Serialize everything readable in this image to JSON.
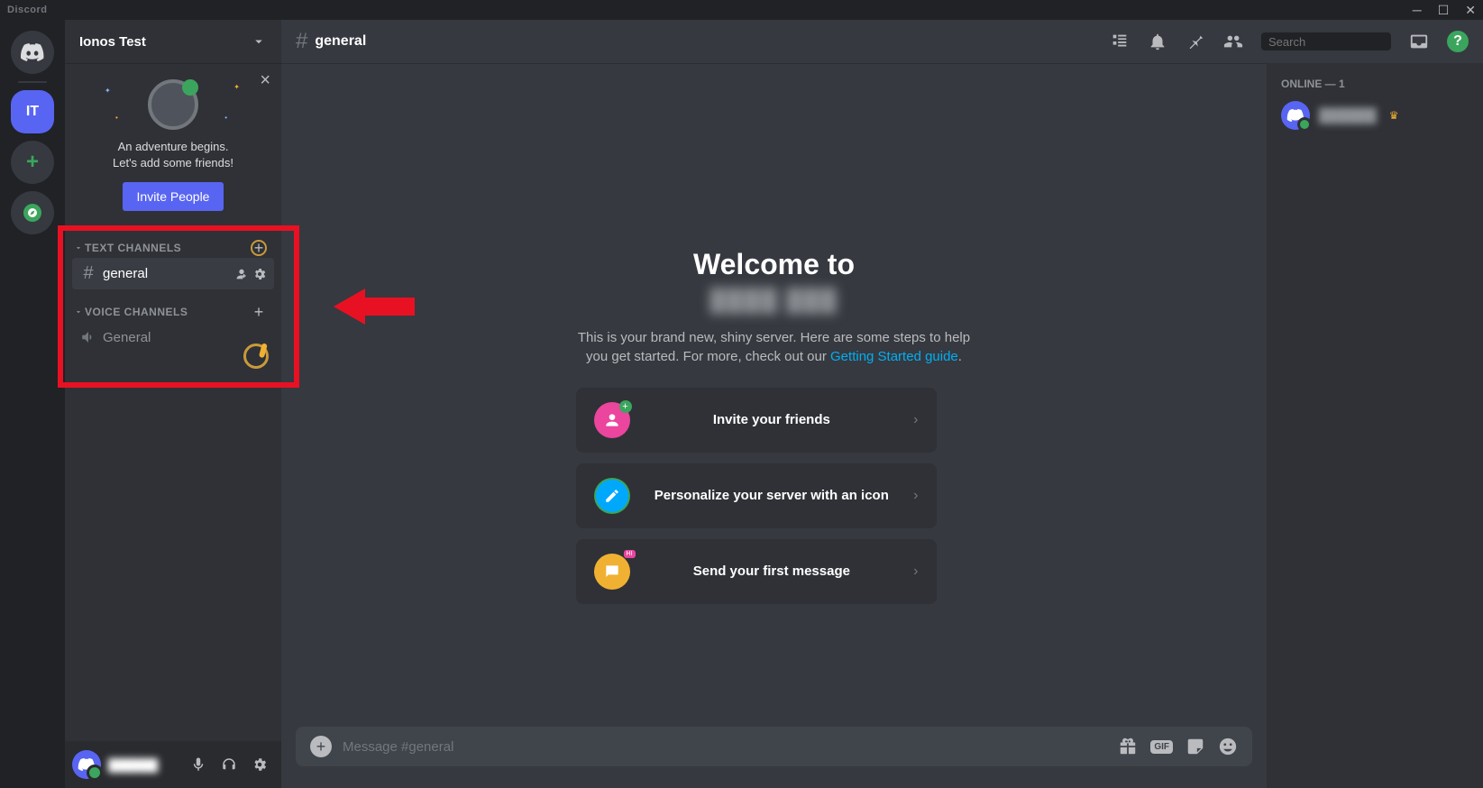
{
  "titlebar": {
    "app_name": "Discord"
  },
  "guilds": {
    "selected_initials": "IT"
  },
  "server": {
    "name": "Ionos Test"
  },
  "sidebar_welcome": {
    "line1": "An adventure begins.",
    "line2": "Let's add some friends!",
    "invite_button": "Invite People"
  },
  "categories": {
    "text": {
      "label": "TEXT CHANNELS",
      "channels": [
        {
          "name": "general",
          "active": true
        }
      ]
    },
    "voice": {
      "label": "VOICE CHANNELS",
      "channels": [
        {
          "name": "General"
        }
      ]
    }
  },
  "header": {
    "channel_name": "general",
    "search_placeholder": "Search"
  },
  "welcome": {
    "title": "Welcome to",
    "server_name_masked": "████ ███",
    "desc_part1": "This is your brand new, shiny server. Here are some steps to help you get started. For more, check out our ",
    "desc_link": "Getting Started guide",
    "desc_part2": "."
  },
  "onboarding": {
    "items": [
      {
        "label": "Invite your friends"
      },
      {
        "label": "Personalize your server with an icon"
      },
      {
        "label": "Send your first message"
      }
    ]
  },
  "message_input": {
    "placeholder": "Message #general"
  },
  "members": {
    "header": "ONLINE — 1",
    "list": [
      {
        "name_masked": "██████"
      }
    ]
  }
}
